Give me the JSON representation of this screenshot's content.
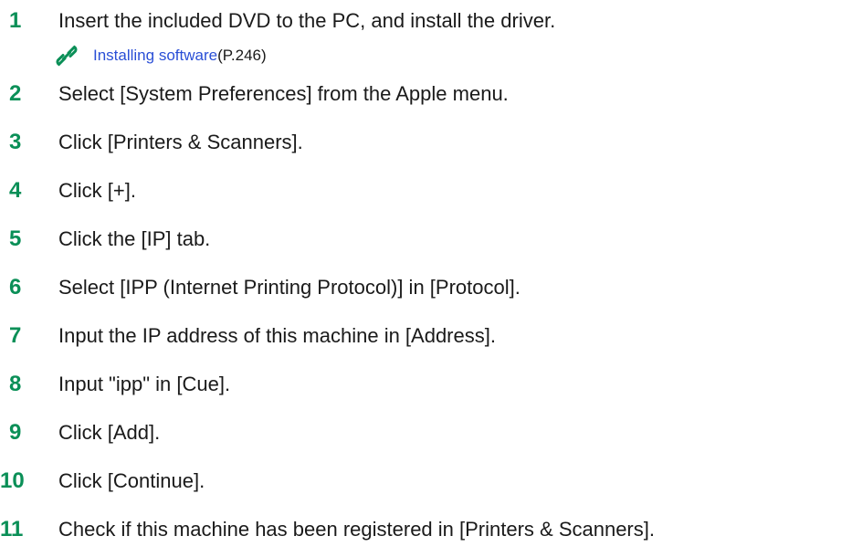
{
  "accent_color": "#0a8f57",
  "link_color": "#2a4fd6",
  "steps": [
    {
      "number": "1",
      "text": "Insert the included DVD to the PC, and install the driver."
    },
    {
      "number": "2",
      "text": "Select [System Preferences] from the Apple menu."
    },
    {
      "number": "3",
      "text": "Click [Printers & Scanners]."
    },
    {
      "number": "4",
      "text": "Click [+]."
    },
    {
      "number": "5",
      "text": "Click the [IP] tab."
    },
    {
      "number": "6",
      "text": "Select [IPP (Internet Printing Protocol)] in [Protocol]."
    },
    {
      "number": "7",
      "text": "Input the IP address of this machine in [Address]."
    },
    {
      "number": "8",
      "text": "Input \"ipp\" in [Cue]."
    },
    {
      "number": "9",
      "text": "Click [Add]."
    },
    {
      "number": "10",
      "text": "Click [Continue]."
    },
    {
      "number": "11",
      "text": "Check if this machine has been registered in [Printers & Scanners]."
    }
  ],
  "reference": {
    "icon": "link-icon",
    "link_text": "Installing software",
    "page": "(P.246)"
  }
}
